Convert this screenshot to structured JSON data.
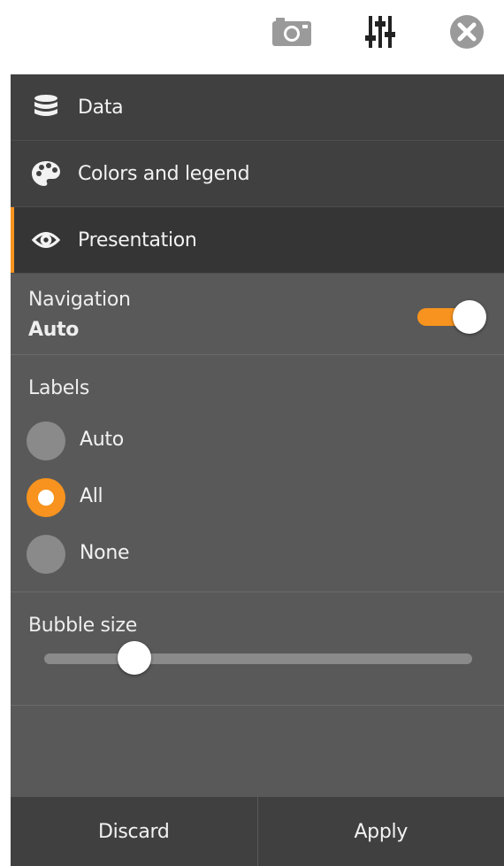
{
  "toolbar": {
    "icons": [
      "camera-icon",
      "sliders-icon",
      "close-icon"
    ]
  },
  "nav": {
    "items": [
      {
        "label": "Data",
        "icon": "database-icon",
        "active": false
      },
      {
        "label": "Colors and legend",
        "icon": "palette-icon",
        "active": false
      },
      {
        "label": "Presentation",
        "icon": "eye-icon",
        "active": true
      }
    ]
  },
  "presentation": {
    "navigation": {
      "title": "Navigation",
      "value": "Auto",
      "toggle_on": true
    },
    "labels": {
      "title": "Labels",
      "options": [
        {
          "label": "Auto",
          "checked": false
        },
        {
          "label": "All",
          "checked": true
        },
        {
          "label": "None",
          "checked": false
        }
      ]
    },
    "bubble_size": {
      "title": "Bubble size",
      "level": 0.21
    }
  },
  "footer": {
    "discard": "Discard",
    "apply": "Apply"
  },
  "colors": {
    "accent": "#f7931e",
    "panel": "#595959",
    "header": "#404040"
  }
}
